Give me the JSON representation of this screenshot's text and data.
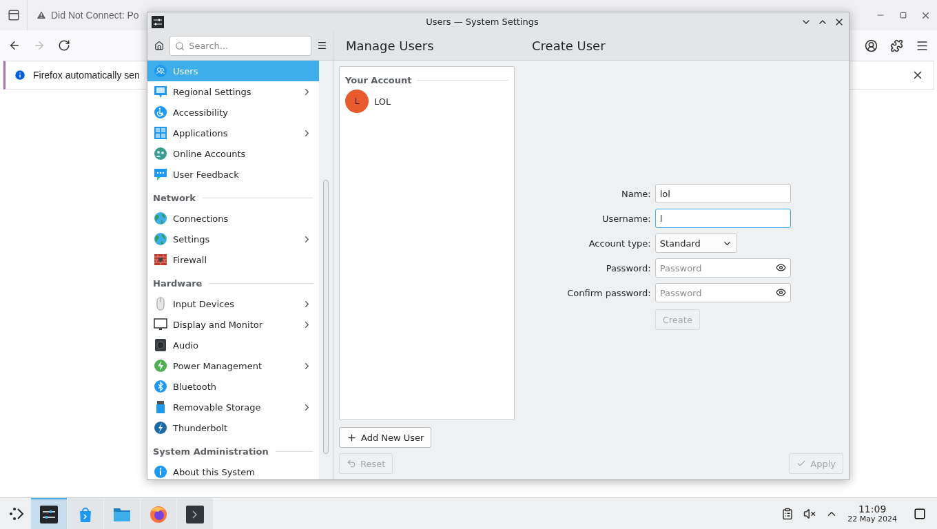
{
  "browser": {
    "tabs": [
      {
        "title": "Did Not Connect: Po",
        "warning": true
      }
    ],
    "nav": [
      {
        "kind": "back",
        "disabled": false
      },
      {
        "kind": "forward",
        "disabled": true
      },
      {
        "kind": "reload",
        "disabled": false
      }
    ],
    "notification": {
      "text": "Firefox automatically sen"
    }
  },
  "settings_window": {
    "title": "Users — System Settings",
    "search": {
      "placeholder": "Search..."
    },
    "sidebar": {
      "groups": [
        {
          "items": [
            {
              "label": "Users",
              "kind": "users",
              "has_children": false,
              "selected": true
            },
            {
              "label": "Regional Settings",
              "kind": "regional",
              "has_children": true,
              "selected": false
            },
            {
              "label": "Accessibility",
              "kind": "accessibility",
              "has_children": false,
              "selected": false
            },
            {
              "label": "Applications",
              "kind": "applications",
              "has_children": true,
              "selected": false
            },
            {
              "label": "Online Accounts",
              "kind": "accounts",
              "has_children": false,
              "selected": false
            },
            {
              "label": "User Feedback",
              "kind": "feedback",
              "has_children": false,
              "selected": false
            }
          ]
        },
        {
          "heading": "Network",
          "items": [
            {
              "label": "Connections",
              "kind": "globe",
              "has_children": false,
              "selected": false
            },
            {
              "label": "Settings",
              "kind": "globe",
              "has_children": true,
              "selected": false
            },
            {
              "label": "Firewall",
              "kind": "firewall",
              "has_children": false,
              "selected": false
            }
          ]
        },
        {
          "heading": "Hardware",
          "items": [
            {
              "label": "Input Devices",
              "kind": "mouse",
              "has_children": true,
              "selected": false
            },
            {
              "label": "Display and Monitor",
              "kind": "monitor",
              "has_children": true,
              "selected": false
            },
            {
              "label": "Audio",
              "kind": "audio",
              "has_children": false,
              "selected": false
            },
            {
              "label": "Power Management",
              "kind": "power",
              "has_children": true,
              "selected": false
            },
            {
              "label": "Bluetooth",
              "kind": "bluetooth",
              "has_children": false,
              "selected": false
            },
            {
              "label": "Removable Storage",
              "kind": "storage",
              "has_children": true,
              "selected": false
            },
            {
              "label": "Thunderbolt",
              "kind": "thunderbolt",
              "has_children": false,
              "selected": false
            }
          ]
        },
        {
          "heading": "System Administration",
          "items": [
            {
              "label": "About this System",
              "kind": "info",
              "has_children": false,
              "selected": false
            }
          ]
        }
      ]
    },
    "headings": [
      "Manage Users",
      "Create User"
    ],
    "accounts": {
      "heading": "Your Account",
      "users": [
        {
          "initial": "L",
          "name": "LOL"
        }
      ]
    },
    "add_button": {
      "label": "Add New User"
    },
    "form": {
      "fields": [
        {
          "label": "Name:",
          "kind": "text",
          "value": "lol",
          "focused": false
        },
        {
          "label": "Username:",
          "kind": "text",
          "value": "l",
          "focused": true
        },
        {
          "label": "Account type:",
          "kind": "select",
          "value": "Standard"
        },
        {
          "label": "Password:",
          "kind": "password",
          "placeholder": "Password"
        },
        {
          "label": "Confirm password:",
          "kind": "password",
          "placeholder": "Password"
        }
      ],
      "submit": {
        "label": "Create",
        "disabled": true
      }
    },
    "reset": {
      "label": "Reset",
      "disabled": true
    },
    "apply": {
      "label": "Apply",
      "disabled": true
    }
  },
  "taskbar": {
    "apps": [
      {
        "kind": "settings",
        "active": true
      },
      {
        "kind": "store",
        "active": false
      },
      {
        "kind": "files",
        "active": false
      },
      {
        "kind": "browser",
        "active": false
      },
      {
        "kind": "terminal",
        "active": false
      }
    ],
    "time": "11:09",
    "date": "22 May 2024"
  }
}
